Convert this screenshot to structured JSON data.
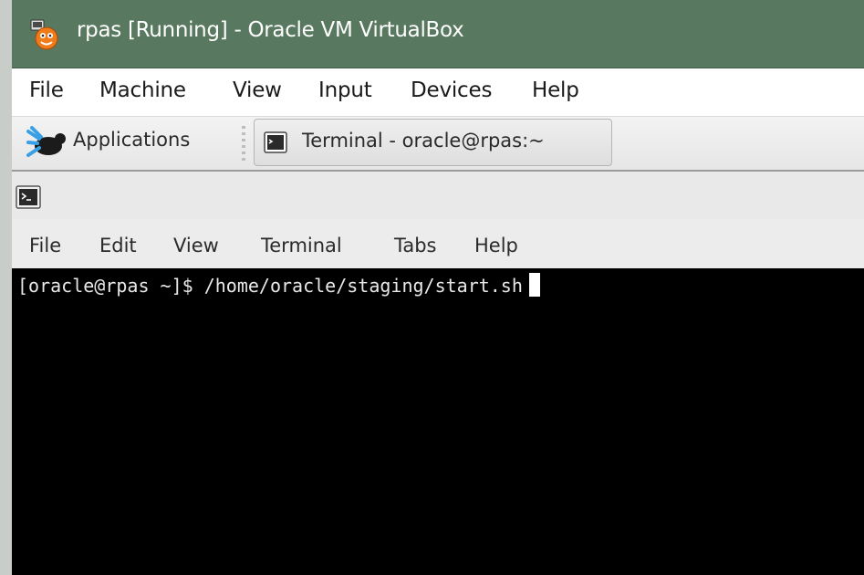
{
  "window": {
    "title": "rpas [Running] - Oracle VM VirtualBox",
    "icon": "virtualbox-icon"
  },
  "vbox_menu": [
    {
      "label": "File"
    },
    {
      "label": "Machine"
    },
    {
      "label": "View"
    },
    {
      "label": "Input"
    },
    {
      "label": "Devices"
    },
    {
      "label": "Help"
    }
  ],
  "guest_panel": {
    "applications_label": "Applications",
    "applications_icon": "xfce-mouse-icon",
    "task_label": "Terminal - oracle@rpas:~",
    "task_icon": "terminal-icon"
  },
  "terminal": {
    "menu": [
      {
        "label": "File"
      },
      {
        "label": "Edit"
      },
      {
        "label": "View"
      },
      {
        "label": "Terminal"
      },
      {
        "label": "Tabs"
      },
      {
        "label": "Help"
      }
    ],
    "prompt": "[oracle@rpas ~]$ ",
    "command": "/home/oracle/staging/start.sh",
    "colors": {
      "background": "#000000",
      "text": "#e8e8e8"
    }
  },
  "colors": {
    "titlebar": "#58795f",
    "menubar": "#ffffff"
  }
}
